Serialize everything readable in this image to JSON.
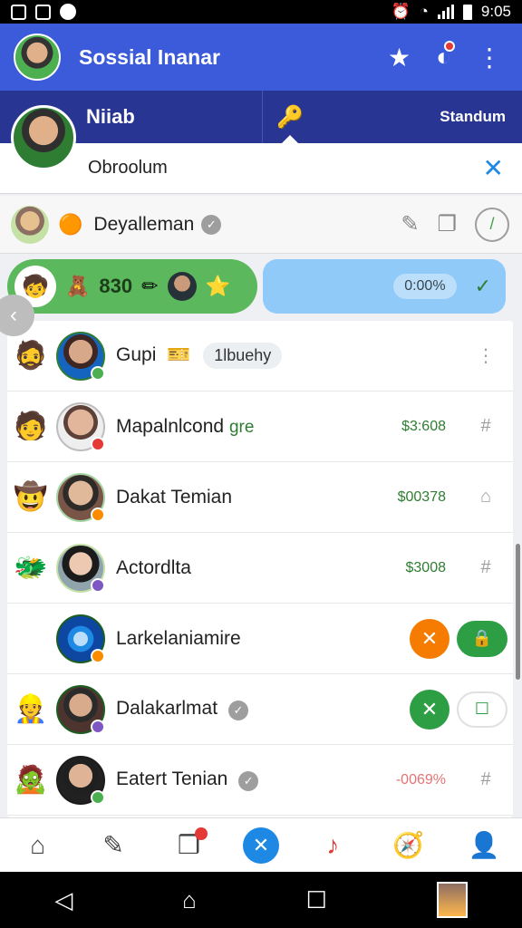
{
  "status_bar": {
    "time": "9:05"
  },
  "app_bar": {
    "title": "Sossial Inanar"
  },
  "band": {
    "name": "Niiab",
    "right_label": "Standum"
  },
  "search": {
    "text": "Obroolum"
  },
  "current_user": {
    "name": "Deyalleman"
  },
  "pill_green": {
    "value": "830"
  },
  "pill_blue": {
    "value": "0:00%"
  },
  "list": [
    {
      "name": "Gupi",
      "tag": "1lbuehy",
      "amount": "",
      "action": "more"
    },
    {
      "name": "Mapalnlcond",
      "suffix": "gre",
      "amount": "$3:608",
      "action": "hash"
    },
    {
      "name": "Dakat Temian",
      "amount": "$00378",
      "action": "home"
    },
    {
      "name": "Actordlta",
      "amount": "$3008",
      "action": "hash"
    },
    {
      "name": "Larkelaniamire",
      "amount": "",
      "action": "buttons-orange-green"
    },
    {
      "name": "Dalakarlmat",
      "amount": "",
      "action": "buttons-green-white"
    },
    {
      "name": "Eatert Tenian",
      "amount": "-0069%",
      "action": "hash",
      "amount_red": true
    }
  ]
}
